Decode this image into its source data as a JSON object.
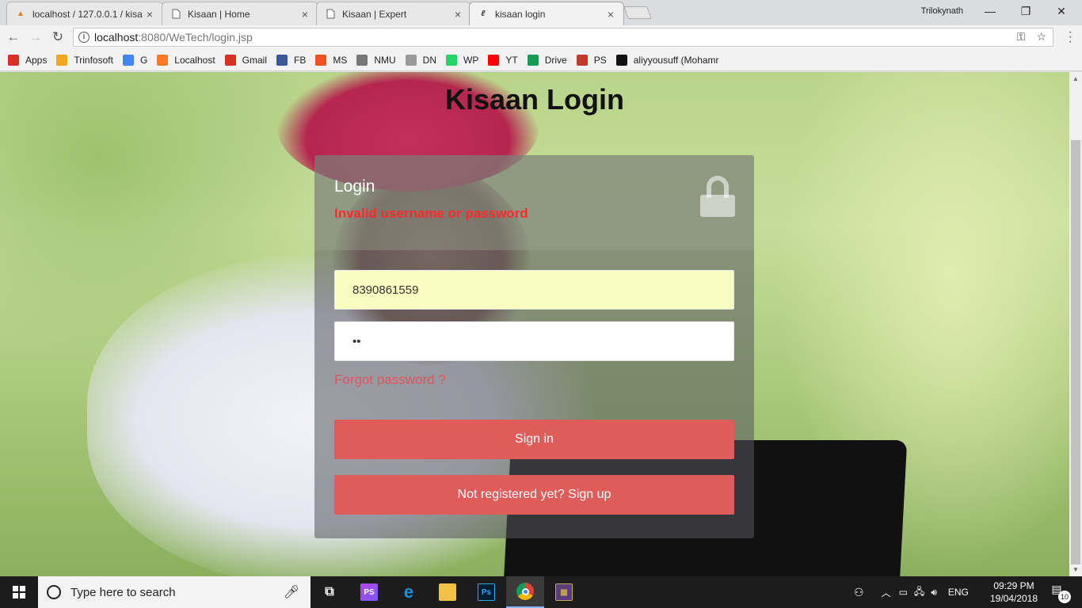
{
  "browser": {
    "tabs": [
      {
        "title": "localhost / 127.0.0.1 / kisa",
        "icon": "phpmyadmin-icon",
        "active": false
      },
      {
        "title": "Kisaan | Home",
        "icon": "page-icon",
        "active": false
      },
      {
        "title": "Kisaan | Expert",
        "icon": "page-icon",
        "active": false
      },
      {
        "title": "kisaan login",
        "icon": "loading-icon",
        "active": true
      }
    ],
    "tab_close_glyph": "×",
    "profile_name": "Trilokynath",
    "url_host": "localhost",
    "url_path": ":8080/WeTech/login.jsp",
    "bookmarks": [
      {
        "label": "Apps",
        "icon": "apps-grid-icon",
        "color": "#d93025"
      },
      {
        "label": "Trinfosoft",
        "icon": "trinfosoft-icon",
        "color": "#f5a623"
      },
      {
        "label": "G",
        "icon": "google-icon",
        "color": "#4285f4"
      },
      {
        "label": "Localhost",
        "icon": "xampp-icon",
        "color": "#fb7a24"
      },
      {
        "label": "Gmail",
        "icon": "gmail-icon",
        "color": "#d93025"
      },
      {
        "label": "FB",
        "icon": "facebook-icon",
        "color": "#3b5998"
      },
      {
        "label": "MS",
        "icon": "microsoft-icon",
        "color": "#f25022"
      },
      {
        "label": "NMU",
        "icon": "nmu-icon",
        "color": "#777777"
      },
      {
        "label": "DN",
        "icon": "page-icon",
        "color": "#999999"
      },
      {
        "label": "WP",
        "icon": "whatsapp-icon",
        "color": "#25d366"
      },
      {
        "label": "YT",
        "icon": "youtube-icon",
        "color": "#ff0000"
      },
      {
        "label": "Drive",
        "icon": "drive-icon",
        "color": "#0f9d58"
      },
      {
        "label": "PS",
        "icon": "ps-icon",
        "color": "#c0392b"
      },
      {
        "label": "aliyyousuff (Mohamr",
        "icon": "github-icon",
        "color": "#111111"
      }
    ]
  },
  "page": {
    "heading": "Kisaan Login",
    "card_title": "Login",
    "error_message": "Invalid username or password",
    "username_value": "8390861559",
    "password_value": "••",
    "forgot_link": "Forgot password ?",
    "signin_label": "Sign in",
    "signup_label": "Not registered yet? Sign up",
    "accent_color": "#de5c5a",
    "error_color": "#ff2a2a"
  },
  "taskbar": {
    "search_placeholder": "Type here to search",
    "apps": [
      {
        "name": "task-view-icon",
        "glyph": "⧉"
      },
      {
        "name": "phpstorm-icon",
        "glyph": "PS"
      },
      {
        "name": "edge-icon",
        "glyph": "e"
      },
      {
        "name": "file-explorer-icon",
        "glyph": "▭"
      },
      {
        "name": "photoshop-icon",
        "glyph": "Ps"
      },
      {
        "name": "chrome-icon",
        "glyph": "◉"
      },
      {
        "name": "game-icon",
        "glyph": "▦"
      }
    ],
    "language": "ENG",
    "time": "09:29 PM",
    "date": "19/04/2018",
    "notification_count": "10"
  }
}
